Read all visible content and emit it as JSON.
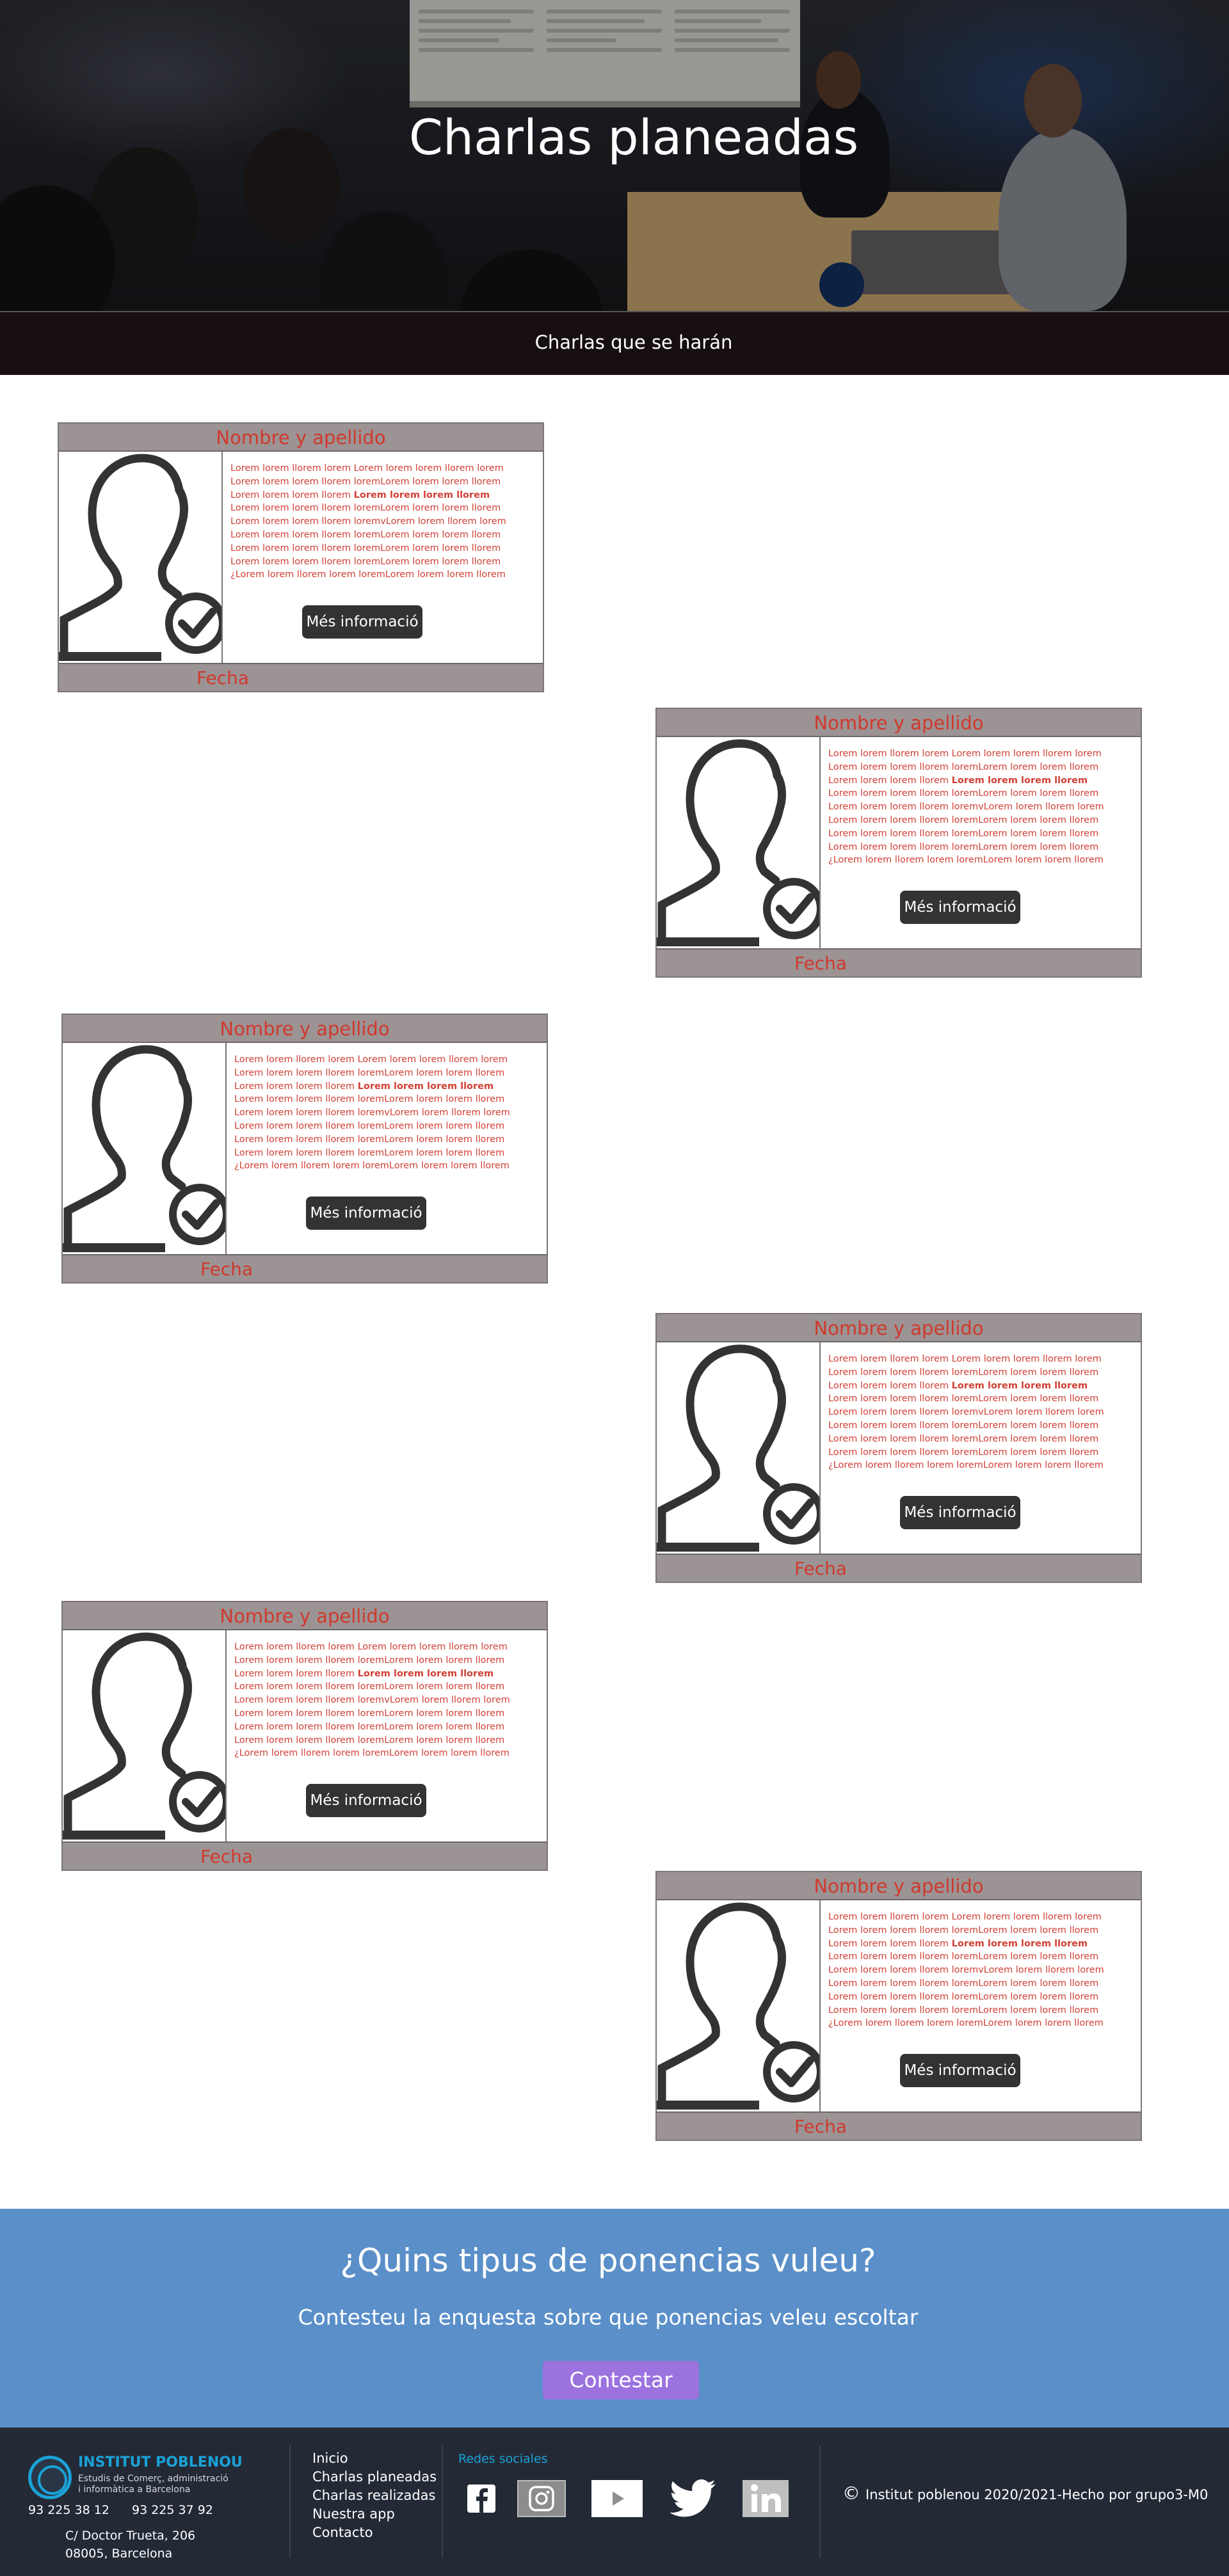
{
  "hero": {
    "title": "Charlas planeadas",
    "subtitle": "Charlas que se harán"
  },
  "card": {
    "name_label": "Nombre y apellido",
    "date_label": "Fecha",
    "button_label": "Més informació",
    "text_lines": [
      "Lorem lorem llorem lorem Lorem lorem lorem llorem lorem",
      "Lorem lorem lorem llorem loremLorem lorem lorem llorem",
      "Lorem lorem lorem llorem ",
      "Lorem lorem lorem llorem loremLorem lorem lorem llorem",
      "Lorem lorem lorem llorem loremvLorem lorem llorem lorem",
      "Lorem lorem lorem llorem loremLorem lorem lorem llorem",
      "Lorem lorem lorem llorem loremLorem lorem lorem llorem",
      "Lorem lorem lorem llorem loremLorem lorem lorem llorem",
      "¿Lorem lorem llorem lorem loremLorem lorem lorem llorem"
    ],
    "bold_text": "Lorem lorem lorem llorem"
  },
  "survey": {
    "title": "¿Quins tipus de ponencias vuleu?",
    "subtitle": "Contesteu la enquesta sobre que ponencias veleu escoltar",
    "button_label": "Contestar"
  },
  "footer": {
    "logo_name": "INSTITUT POBLENOU",
    "logo_desc_1": "Estudis de Comerç, administració",
    "logo_desc_2": "i informàtica a Barcelona",
    "phone_1": "93 225 38 12",
    "phone_2": "93 225 37 92",
    "address_1": "C/ Doctor Trueta, 206",
    "address_2": "08005, Barcelona",
    "nav": [
      "Inicio",
      "Charlas planeadas",
      "Charlas realizadas",
      "Nuestra app",
      "Contacto"
    ],
    "social_title": "Redes sociales",
    "social_icons": [
      "facebook-icon",
      "instagram-icon",
      "youtube-icon",
      "twitter-icon",
      "linkedin-icon"
    ],
    "copyright_symbol": "©",
    "copyright": "Institut poblenou 2020/2021-Hecho por grupo3-M0"
  },
  "colors": {
    "name_red": "#d0392d",
    "card_header_grey": "#9c9394",
    "survey_blue": "#5a8fc9",
    "survey_button_purple": "#9c72df",
    "footer_bg": "#232a36",
    "footer_accent": "#1aa2d8"
  }
}
